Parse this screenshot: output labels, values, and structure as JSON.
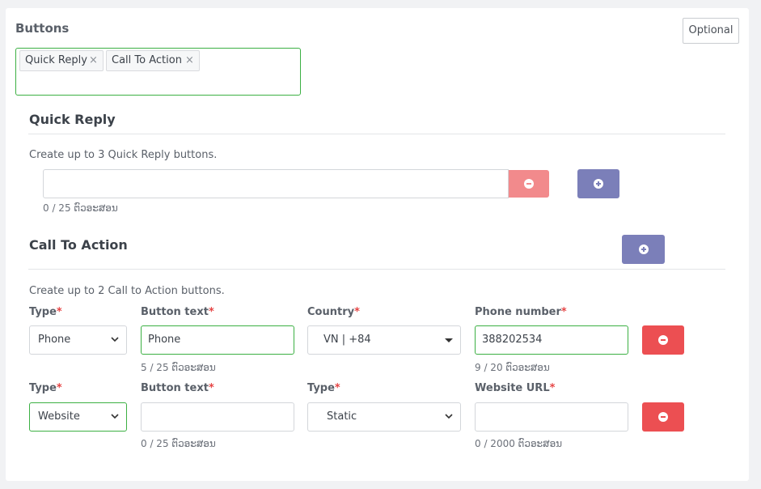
{
  "section": {
    "title": "Buttons",
    "optional_label": "Optional"
  },
  "tags": [
    {
      "label": "Quick Reply",
      "remove": "×"
    },
    {
      "label": "Call To Action",
      "remove": "×"
    }
  ],
  "quick_reply": {
    "title": "Quick Reply",
    "description": "Create up to 3 Quick Reply buttons.",
    "input_value": "",
    "counter": "0 / 25 ຕົວອະສອນ"
  },
  "call_to_action": {
    "title": "Call To Action",
    "description": "Create up to 2 Call to Action buttons.",
    "row1": {
      "type_label": "Type",
      "type_value": "Phone",
      "button_text_label": "Button text",
      "button_text_value": "Phone",
      "button_text_counter": "5 / 25 ຕົວອະສອນ",
      "country_label": "Country",
      "country_value": "VN | +84",
      "phone_label": "Phone number",
      "phone_value": "388202534",
      "phone_counter": "9 / 20 ຕົວອະສອນ"
    },
    "row2": {
      "type_label": "Type",
      "type_value": "Website",
      "button_text_label": "Button text",
      "button_text_value": "",
      "button_text_counter": "0 / 25 ຕົວອະສອນ",
      "url_type_label": "Type",
      "url_type_value": "Static",
      "url_label": "Website URL",
      "url_value": "",
      "url_counter": "0 / 2000 ຕົວອະສອນ"
    }
  },
  "required_mark": "*",
  "colors": {
    "tag_border_active": "#3cb043",
    "remove_button": "#ec4f52",
    "remove_button_light": "#f28a8c",
    "add_button": "#7b7fb9",
    "required": "#e64545"
  },
  "icons": {
    "remove": "minus-circle-icon",
    "add": "plus-circle-icon",
    "caret": "chevron-down-icon",
    "dropdown": "caret-down-icon"
  }
}
